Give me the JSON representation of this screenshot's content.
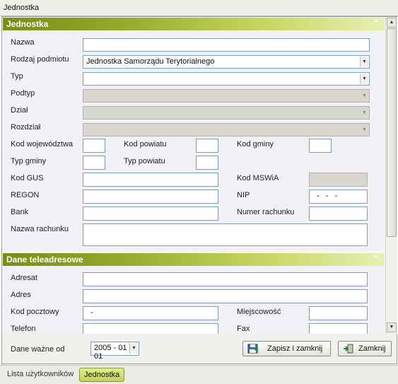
{
  "window": {
    "title": "Jednostka"
  },
  "section1": {
    "title": "Jednostka",
    "fields": {
      "nazwa": {
        "label": "Nazwa",
        "value": ""
      },
      "rodzaj": {
        "label": "Rodzaj podmiotu",
        "value": "Jednostka Samorządu Terytorialnego"
      },
      "typ": {
        "label": "Typ",
        "value": ""
      },
      "podtyp": {
        "label": "Podtyp",
        "value": ""
      },
      "dzial": {
        "label": "Dział",
        "value": ""
      },
      "rozdzial": {
        "label": "Rozdział",
        "value": ""
      },
      "kod_woj": {
        "label": "Kod województwa",
        "value": ""
      },
      "kod_powiatu": {
        "label": "Kod powiatu",
        "value": ""
      },
      "kod_gminy": {
        "label": "Kod gminy",
        "value": ""
      },
      "typ_gminy": {
        "label": "Typ gminy",
        "value": ""
      },
      "typ_powiatu": {
        "label": "Typ powiatu",
        "value": ""
      },
      "kod_gus": {
        "label": "Kod GUS",
        "value": ""
      },
      "kod_mswia": {
        "label": "Kod MSWiA",
        "value": ""
      },
      "regon": {
        "label": "REGON",
        "value": ""
      },
      "nip": {
        "label": "NIP",
        "value": "-   -   -"
      },
      "bank": {
        "label": "Bank",
        "value": ""
      },
      "numer_rachunku": {
        "label": "Numer rachunku",
        "value": ""
      },
      "nazwa_rachunku": {
        "label": "Nazwa rachunku",
        "value": ""
      }
    }
  },
  "section2": {
    "title": "Dane teleadresowe",
    "fields": {
      "adresat": {
        "label": "Adresat",
        "value": ""
      },
      "adres": {
        "label": "Adres",
        "value": ""
      },
      "kod_pocztowy": {
        "label": "Kod pocztowy",
        "value": "-"
      },
      "miejscowosc": {
        "label": "Miejscowość",
        "value": ""
      },
      "telefon": {
        "label": "Telefon",
        "value": ""
      },
      "fax": {
        "label": "Fax",
        "value": ""
      }
    }
  },
  "footer": {
    "date_label": "Dane ważne od",
    "date_value": "2005 - 01 - 01",
    "save_label": "Zapisz i zamknij",
    "close_label": "Zamknij"
  },
  "tabs": [
    {
      "label": "Lista użytkowników",
      "active": false
    },
    {
      "label": "Jednostka",
      "active": true
    }
  ],
  "colors": {
    "accent": "#94a82a",
    "input_border": "#7f9db9",
    "disabled_bg": "#d9d6d0"
  },
  "icons": {
    "collapse": "double-chevron-up-icon",
    "save": "save-disk-icon",
    "close": "exit-door-icon"
  }
}
